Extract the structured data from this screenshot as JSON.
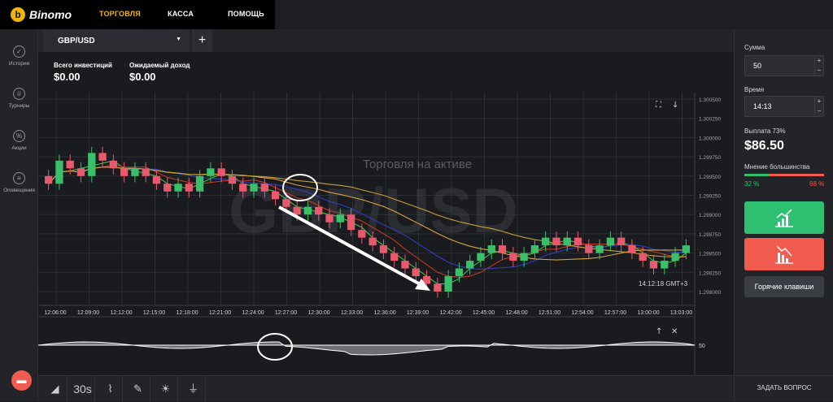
{
  "header": {
    "brand": "Binomo",
    "nav": [
      "ТОРГОВЛЯ",
      "КАССА",
      "ПОМОЩЬ"
    ]
  },
  "sidebar": {
    "items": [
      {
        "label": "История",
        "icon": "check-circle-icon"
      },
      {
        "label": "Турниры",
        "icon": "trophy-icon"
      },
      {
        "label": "Акции",
        "icon": "percent-icon"
      },
      {
        "label": "Оповещения",
        "icon": "list-icon"
      }
    ],
    "chat_icon": "chat-bubble-icon"
  },
  "tabs": {
    "asset": "GBP/USD",
    "add_label": "+"
  },
  "stats": {
    "investments_label": "Всего инвестиций",
    "investments_value": "$0.00",
    "income_label": "Ожидаемый доход",
    "income_value": "$0.00"
  },
  "chart_data": {
    "type": "candlestick",
    "watermark_asset": "GBP/USD",
    "watermark_text": "Торговля на активе",
    "price_ticks": [
      "1.300500",
      "1.300250",
      "1.300000",
      "1.299750",
      "1.299500",
      "1.299250",
      "1.299000",
      "1.298750",
      "1.298500",
      "1.298250",
      "1.298000"
    ],
    "time_ticks": [
      "12:06:00",
      "12:09:00",
      "12:12:00",
      "12:15:00",
      "12:18:00",
      "12:21:00",
      "12:24:00",
      "12:27:00",
      "12:30:00",
      "12:33:00",
      "12:36:00",
      "12:39:00",
      "12:42:00",
      "12:45:00",
      "12:48:00",
      "12:51:00",
      "12:54:00",
      "12:57:00",
      "13:00:00",
      "13:03:00"
    ],
    "current_time": "14:12:18 GMT+3",
    "candle_close": [
      1.2994,
      1.2997,
      1.2996,
      1.2995,
      1.2998,
      1.2997,
      1.2996,
      1.2995,
      1.2996,
      1.2995,
      1.2994,
      1.2993,
      1.2994,
      1.2993,
      1.2995,
      1.2996,
      1.2995,
      1.2994,
      1.2993,
      1.2994,
      1.2993,
      1.2992,
      1.2991,
      1.299,
      1.2991,
      1.299,
      1.2989,
      1.299,
      1.2988,
      1.2987,
      1.2986,
      1.2985,
      1.2984,
      1.2983,
      1.2982,
      1.2981,
      1.298,
      1.2982,
      1.2983,
      1.2984,
      1.2985,
      1.2986,
      1.2985,
      1.2984,
      1.2985,
      1.2986,
      1.2987,
      1.2986,
      1.2987,
      1.2986,
      1.2985,
      1.2986,
      1.2987,
      1.2986,
      1.2985,
      1.2984,
      1.2983,
      1.2984,
      1.2985,
      1.2986
    ],
    "oscillator_level": "50"
  },
  "chart_controls": {
    "fullscreen_icon": "fullscreen-icon",
    "download_icon": "arrow-down-icon",
    "osc_up_icon": "arrow-up-icon",
    "osc_close_icon": "close-icon"
  },
  "bottom_tools": [
    {
      "icon": "chart-type-icon",
      "label": ""
    },
    {
      "icon": "timeframe-label",
      "label": "30s"
    },
    {
      "icon": "indicators-icon",
      "label": ""
    },
    {
      "icon": "drawing-tools-icon",
      "label": ""
    },
    {
      "icon": "brightness-icon",
      "label": ""
    },
    {
      "icon": "plug-icon",
      "label": ""
    }
  ],
  "right_panel": {
    "amount_label": "Сумма",
    "amount_value": "50",
    "time_label": "Время",
    "time_value": "14:13",
    "payout_label": "Выплата 73%",
    "payout_value": "$86.50",
    "sentiment_label": "Мнение большинства",
    "up_percent": "32 %",
    "down_percent": "68 %",
    "hotkeys_label": "Горячие клавиши",
    "ask_label": "ЗАДАТЬ ВОПРОС",
    "colors": {
      "up": "#2fbf71",
      "down": "#f15b50"
    }
  }
}
